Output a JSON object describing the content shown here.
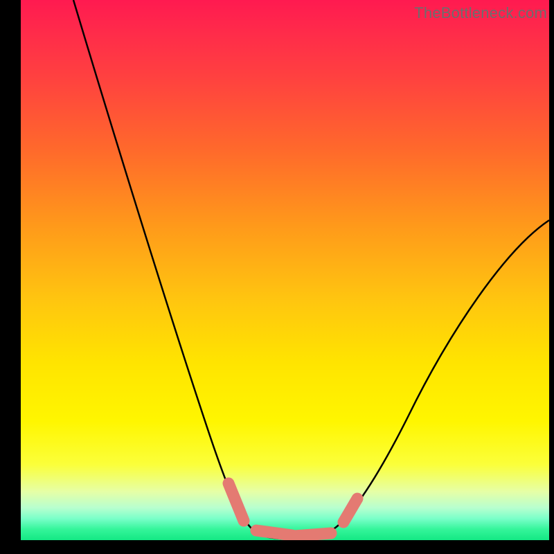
{
  "watermark": "TheBottleneck.com",
  "chart_data": {
    "type": "line",
    "title": "",
    "xlabel": "",
    "ylabel": "",
    "xlim": [
      0,
      100
    ],
    "ylim": [
      0,
      100
    ],
    "series": [
      {
        "name": "bottleneck-curve",
        "x": [
          10,
          15,
          20,
          25,
          30,
          35,
          40,
          43,
          46,
          49,
          52,
          55,
          60,
          65,
          70,
          75,
          80,
          85,
          90,
          95,
          100
        ],
        "values": [
          100,
          86,
          72,
          59,
          46,
          33,
          20,
          11,
          4,
          1,
          0,
          0,
          1,
          4,
          10,
          17,
          25,
          33,
          41,
          50,
          59
        ]
      }
    ],
    "markers": [
      {
        "name": "pill-1",
        "x1": 40.0,
        "y1": 11.0,
        "x2": 43.2,
        "y2": 3.0
      },
      {
        "name": "pill-2",
        "x1": 45.0,
        "y1": 1.5,
        "x2": 52.0,
        "y2": 0.5
      },
      {
        "name": "pill-3",
        "x1": 52.0,
        "y1": 0.5,
        "x2": 59.0,
        "y2": 1.0
      },
      {
        "name": "pill-4",
        "x1": 61.5,
        "y1": 3.0,
        "x2": 64.0,
        "y2": 8.0
      }
    ]
  }
}
